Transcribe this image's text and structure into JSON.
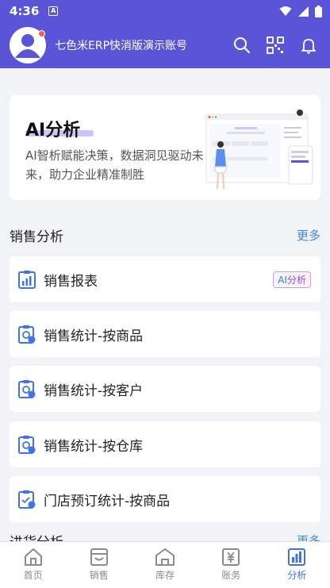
{
  "status": {
    "time": "4:36",
    "a_icon": "A"
  },
  "header": {
    "title": "七色米ERP快消版演示账号"
  },
  "banner": {
    "title": "AI分析",
    "subtitle": "AI智析赋能决策，数据洞见驱动未来，助力企业精准制胜"
  },
  "sales": {
    "title": "销售分析",
    "more": "更多",
    "items": [
      {
        "label": "销售报表",
        "badge_a": "AI",
        "badge_b": "分析"
      },
      {
        "label": "销售统计-按商品"
      },
      {
        "label": "销售统计-按客户"
      },
      {
        "label": "销售统计-按仓库"
      },
      {
        "label": "门店预订统计-按商品"
      }
    ]
  },
  "purchase": {
    "title": "进货分析",
    "more": "更多"
  },
  "tabs": [
    {
      "label": "首页",
      "icon": "home-icon"
    },
    {
      "label": "销售",
      "icon": "store-icon"
    },
    {
      "label": "库存",
      "icon": "warehouse-icon"
    },
    {
      "label": "账务",
      "icon": "yen-icon"
    },
    {
      "label": "分析",
      "icon": "bar-chart-icon",
      "active": true
    }
  ],
  "colors": {
    "primary": "#5a55d6",
    "accent": "#3f86e8",
    "active_tab": "#3f73e6"
  }
}
